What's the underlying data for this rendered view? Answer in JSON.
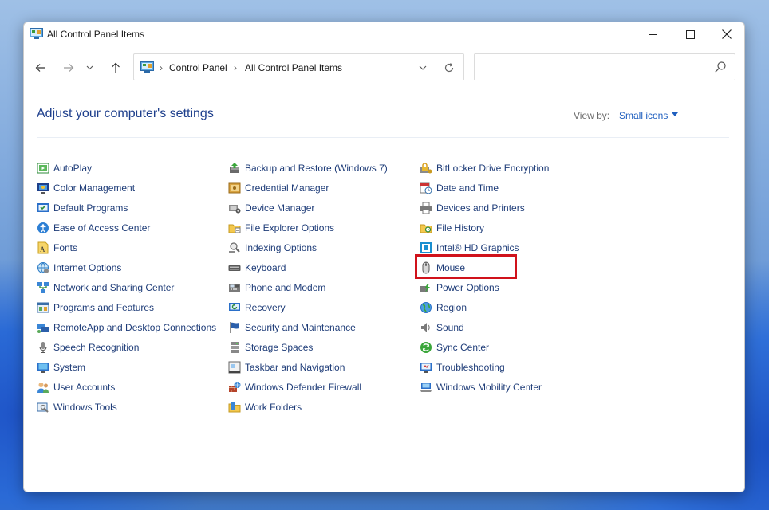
{
  "window": {
    "title": "All Control Panel Items"
  },
  "address": {
    "crumbs": [
      "Control Panel",
      "All Control Panel Items"
    ]
  },
  "search": {
    "placeholder": ""
  },
  "header": {
    "title": "Adjust your computer's settings",
    "view_by_label": "View by:",
    "view_by_value": "Small icons"
  },
  "columns": [
    [
      {
        "label": "AutoPlay",
        "icon": "autoplay-icon"
      },
      {
        "label": "Color Management",
        "icon": "color-management-icon"
      },
      {
        "label": "Default Programs",
        "icon": "default-programs-icon"
      },
      {
        "label": "Ease of Access Center",
        "icon": "ease-of-access-icon"
      },
      {
        "label": "Fonts",
        "icon": "fonts-icon"
      },
      {
        "label": "Internet Options",
        "icon": "internet-options-icon"
      },
      {
        "label": "Network and Sharing Center",
        "icon": "network-icon"
      },
      {
        "label": "Programs and Features",
        "icon": "programs-icon"
      },
      {
        "label": "RemoteApp and Desktop Connections",
        "icon": "remoteapp-icon"
      },
      {
        "label": "Speech Recognition",
        "icon": "microphone-icon"
      },
      {
        "label": "System",
        "icon": "system-icon"
      },
      {
        "label": "User Accounts",
        "icon": "user-accounts-icon"
      },
      {
        "label": "Windows Tools",
        "icon": "windows-tools-icon"
      }
    ],
    [
      {
        "label": "Backup and Restore (Windows 7)",
        "icon": "backup-icon"
      },
      {
        "label": "Credential Manager",
        "icon": "credential-icon"
      },
      {
        "label": "Device Manager",
        "icon": "device-manager-icon"
      },
      {
        "label": "File Explorer Options",
        "icon": "folder-options-icon"
      },
      {
        "label": "Indexing Options",
        "icon": "indexing-icon"
      },
      {
        "label": "Keyboard",
        "icon": "keyboard-icon"
      },
      {
        "label": "Phone and Modem",
        "icon": "phone-icon"
      },
      {
        "label": "Recovery",
        "icon": "recovery-icon"
      },
      {
        "label": "Security and Maintenance",
        "icon": "flag-icon"
      },
      {
        "label": "Storage Spaces",
        "icon": "storage-icon"
      },
      {
        "label": "Taskbar and Navigation",
        "icon": "taskbar-icon"
      },
      {
        "label": "Windows Defender Firewall",
        "icon": "firewall-icon"
      },
      {
        "label": "Work Folders",
        "icon": "work-folders-icon"
      }
    ],
    [
      {
        "label": "BitLocker Drive Encryption",
        "icon": "bitlocker-icon"
      },
      {
        "label": "Date and Time",
        "icon": "clock-icon"
      },
      {
        "label": "Devices and Printers",
        "icon": "printer-icon"
      },
      {
        "label": "File History",
        "icon": "file-history-icon"
      },
      {
        "label": "Intel® HD Graphics",
        "icon": "intel-graphics-icon"
      },
      {
        "label": "Mouse",
        "icon": "mouse-icon"
      },
      {
        "label": "Power Options",
        "icon": "power-icon"
      },
      {
        "label": "Region",
        "icon": "globe-icon"
      },
      {
        "label": "Sound",
        "icon": "speaker-icon"
      },
      {
        "label": "Sync Center",
        "icon": "sync-icon"
      },
      {
        "label": "Troubleshooting",
        "icon": "troubleshooting-icon"
      },
      {
        "label": "Windows Mobility Center",
        "icon": "mobility-icon"
      }
    ]
  ],
  "colors": {
    "link": "#1e3c78",
    "title": "#1e3f8c",
    "highlight": "#d0121b"
  }
}
